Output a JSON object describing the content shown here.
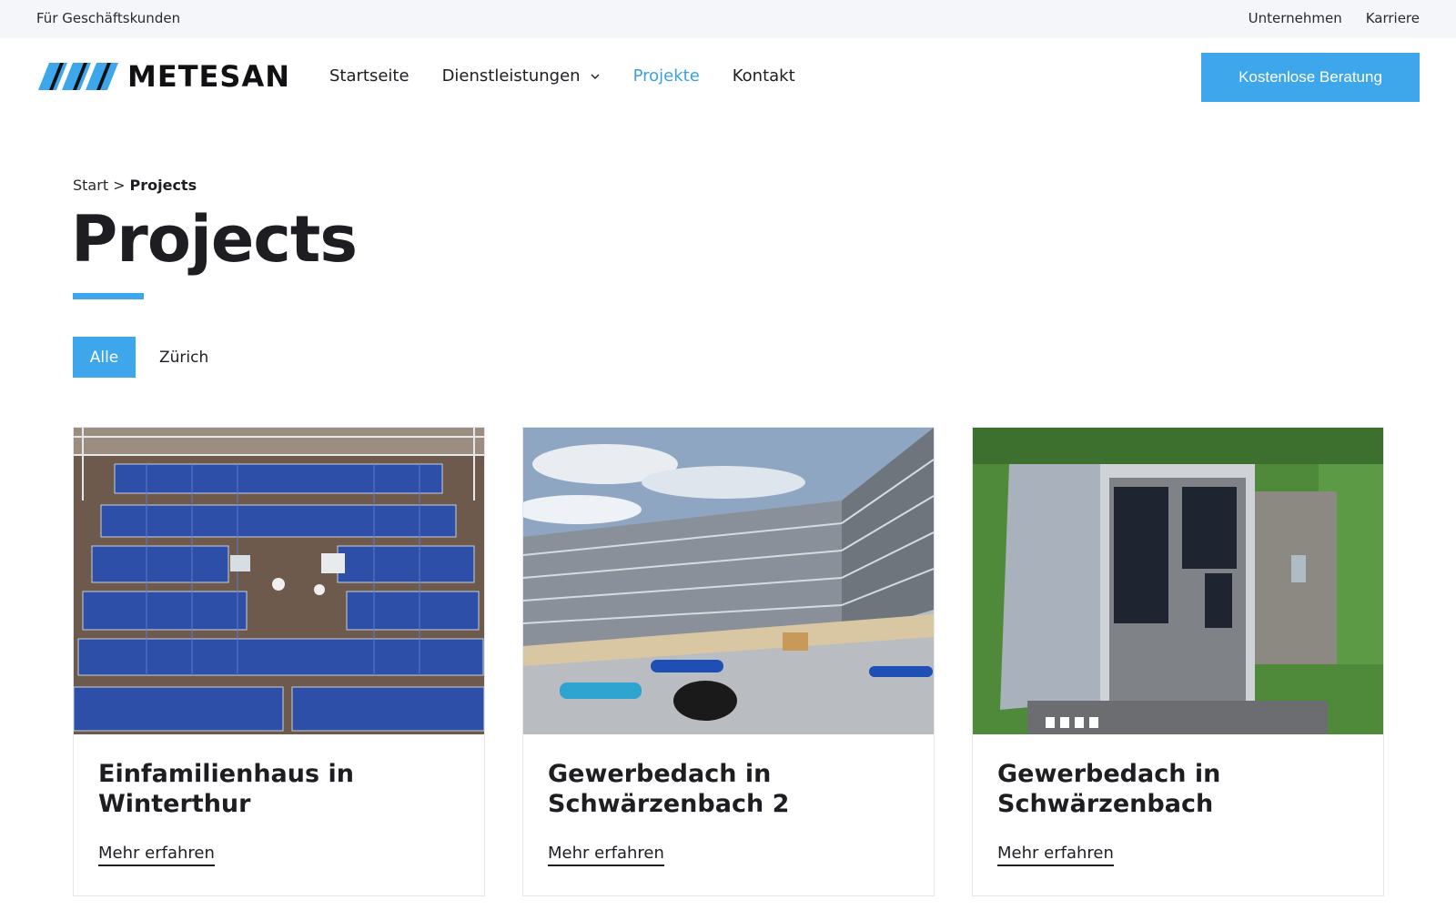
{
  "topbar": {
    "business_link": "Für Geschäftskunden",
    "links": [
      "Unternehmen",
      "Karriere"
    ]
  },
  "header": {
    "brand": "METESAN",
    "nav": [
      {
        "label": "Startseite",
        "active": false
      },
      {
        "label": "Dienstleistungen",
        "active": false,
        "has_dropdown": true
      },
      {
        "label": "Projekte",
        "active": true
      },
      {
        "label": "Kontakt",
        "active": false
      }
    ],
    "cta_label": "Kostenlose Beratung"
  },
  "breadcrumb": {
    "home": "Start",
    "separator": ">",
    "current": "Projects"
  },
  "page": {
    "title": "Projects"
  },
  "filters": [
    {
      "label": "Alle",
      "active": true
    },
    {
      "label": "Zürich",
      "active": false
    }
  ],
  "projects": [
    {
      "title": "Einfamilienhaus in Winterthur",
      "link_label": "Mehr erfahren",
      "image": "rooftop-solar-panels-aerial-photo"
    },
    {
      "title": "Gewerbedach in Schwärzenbach 2",
      "link_label": "Mehr erfahren",
      "image": "building-with-scaffolding-photo"
    },
    {
      "title": "Gewerbedach in Schwärzenbach",
      "link_label": "Mehr erfahren",
      "image": "commercial-roof-aerial-photo"
    }
  ],
  "colors": {
    "accent": "#3ea7ec",
    "active_nav": "#3aa0e6",
    "text": "#1d1d22",
    "topbar_bg": "#f4f6f9"
  }
}
